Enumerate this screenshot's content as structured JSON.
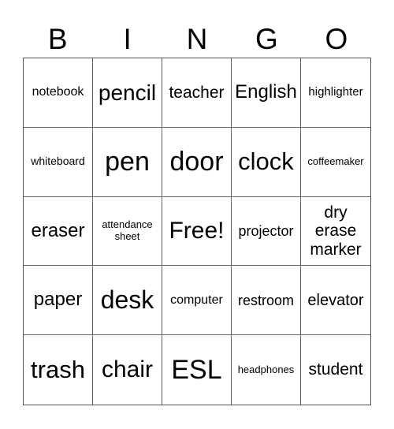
{
  "header": [
    "B",
    "I",
    "N",
    "G",
    "O"
  ],
  "cells": [
    {
      "text": "notebook",
      "size": 16
    },
    {
      "text": "pencil",
      "size": 28
    },
    {
      "text": "teacher",
      "size": 21
    },
    {
      "text": "English",
      "size": 24
    },
    {
      "text": "highlighter",
      "size": 15
    },
    {
      "text": "whiteboard",
      "size": 14
    },
    {
      "text": "pen",
      "size": 34
    },
    {
      "text": "door",
      "size": 34
    },
    {
      "text": "clock",
      "size": 31
    },
    {
      "text": "coffeemaker",
      "size": 13
    },
    {
      "text": "eraser",
      "size": 24
    },
    {
      "text": "attendance sheet",
      "size": 13
    },
    {
      "text": "Free!",
      "size": 30
    },
    {
      "text": "projector",
      "size": 18
    },
    {
      "text": "dry erase marker",
      "size": 21
    },
    {
      "text": "paper",
      "size": 24
    },
    {
      "text": "desk",
      "size": 32
    },
    {
      "text": "computer",
      "size": 16
    },
    {
      "text": "restroom",
      "size": 18
    },
    {
      "text": "elevator",
      "size": 20
    },
    {
      "text": "trash",
      "size": 31
    },
    {
      "text": "chair",
      "size": 30
    },
    {
      "text": "ESL",
      "size": 34
    },
    {
      "text": "headphones",
      "size": 13
    },
    {
      "text": "student",
      "size": 21
    }
  ]
}
